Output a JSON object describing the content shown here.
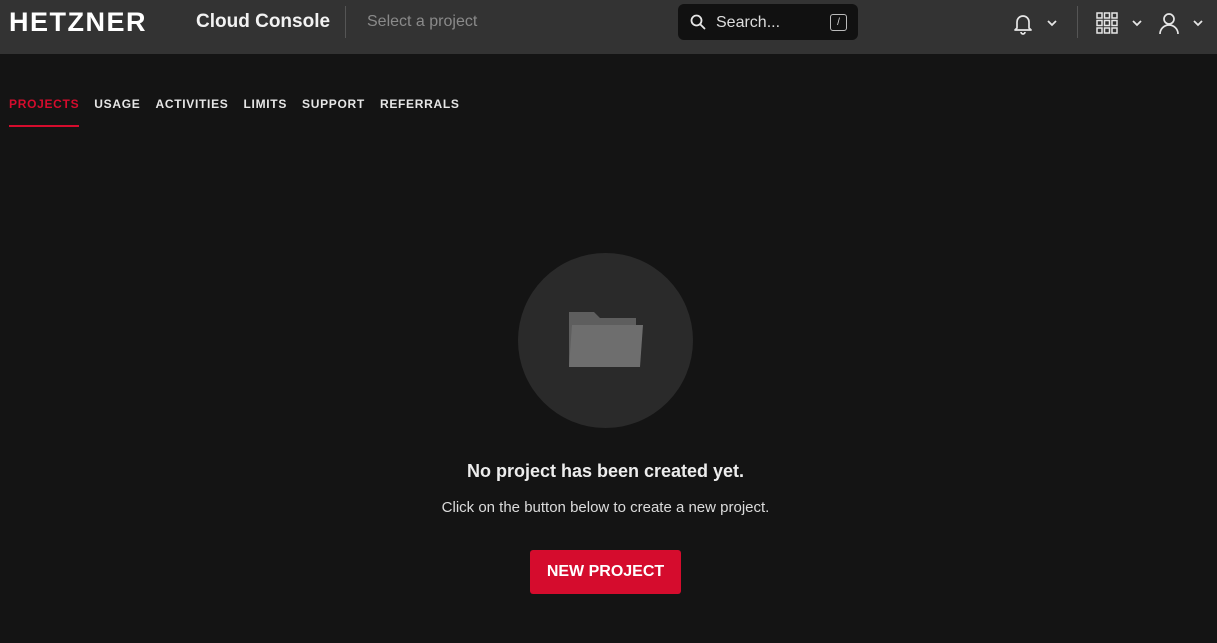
{
  "header": {
    "logo_text": "HETZNER",
    "app_title": "Cloud Console",
    "project_placeholder": "Select a project",
    "search": {
      "placeholder": "Search...",
      "shortcut": "/"
    },
    "icons": [
      "bell-icon",
      "apps-grid-icon",
      "user-icon"
    ]
  },
  "tabs": [
    {
      "label": "PROJECTS",
      "active": true
    },
    {
      "label": "USAGE",
      "active": false
    },
    {
      "label": "ACTIVITIES",
      "active": false
    },
    {
      "label": "LIMITS",
      "active": false
    },
    {
      "label": "SUPPORT",
      "active": false
    },
    {
      "label": "REFERRALS",
      "active": false
    }
  ],
  "empty_state": {
    "icon": "folder-icon",
    "title": "No project has been created yet.",
    "description": "Click on the button below to create a new project.",
    "button_label": "NEW PROJECT"
  },
  "colors": {
    "accent": "#d50c2d",
    "background": "#141414",
    "topbar": "#333333",
    "circle": "#2a2a2a"
  }
}
